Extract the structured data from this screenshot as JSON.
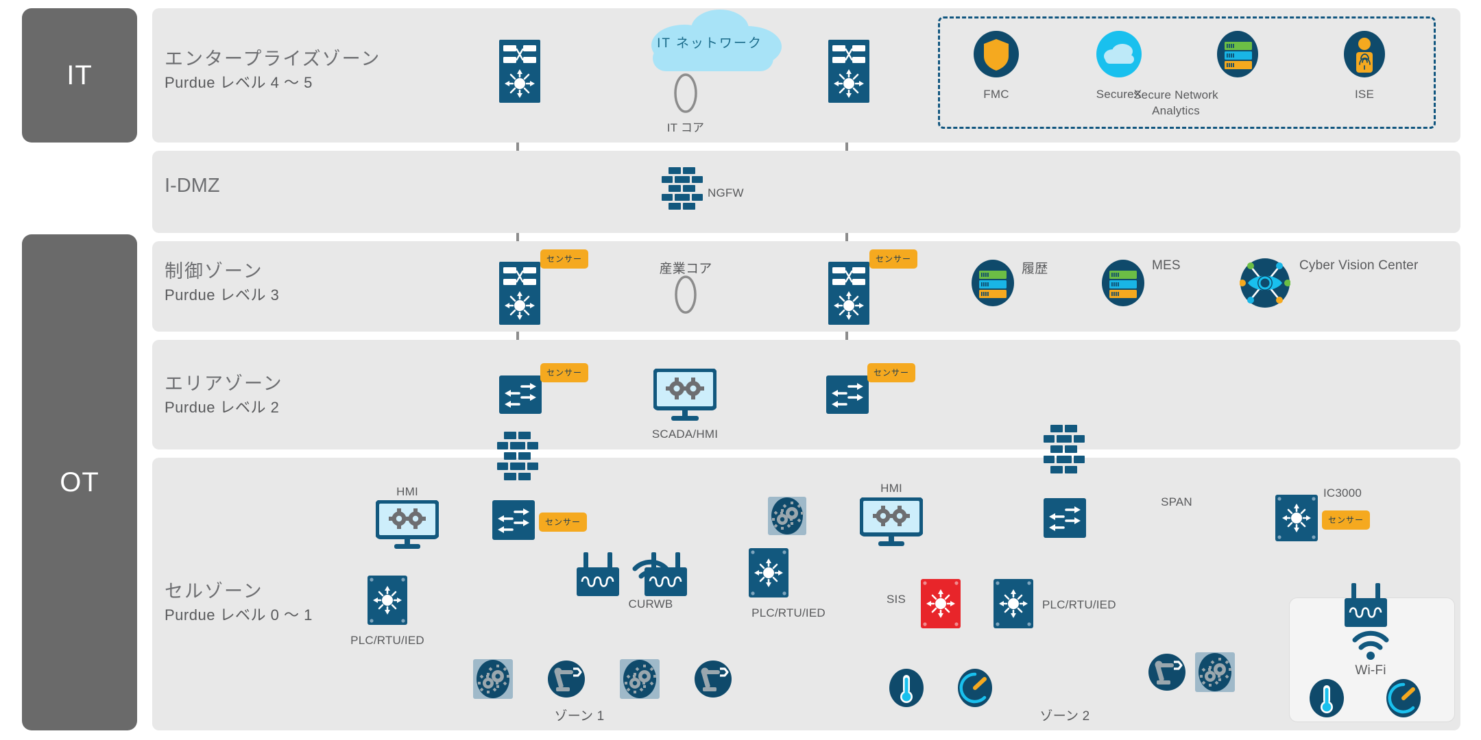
{
  "sidebars": [
    {
      "label": "IT",
      "name": "it-column"
    },
    {
      "label": "OT",
      "name": "ot-column"
    }
  ],
  "zones": [
    {
      "id": "enterprise",
      "title": "エンタープライズゾーン",
      "subtitle": "Purdue レベル 4 〜 5"
    },
    {
      "id": "idmz",
      "title": "I-DMZ",
      "subtitle": ""
    },
    {
      "id": "control",
      "title": "制御ゾーン",
      "subtitle": "Purdue レベル 3"
    },
    {
      "id": "area",
      "title": "エリアゾーン",
      "subtitle": "Purdue レベル 2"
    },
    {
      "id": "cell",
      "title": "セルゾーン",
      "subtitle": "Purdue レベル 0 〜 1"
    }
  ],
  "enterprise": {
    "cloud_label": "IT ネットワーク",
    "core_label": "IT コア",
    "security_tools": [
      {
        "label": "FMC",
        "icon": "shield-icon"
      },
      {
        "label": "SecureX",
        "icon": "cloud-icon"
      },
      {
        "label": "Secure Network Analytics",
        "icon": "server-stack-icon"
      },
      {
        "label": "ISE",
        "icon": "fingerprint-person-icon"
      }
    ]
  },
  "idmz": {
    "firewall_label": "NGFW"
  },
  "control": {
    "core_label": "産業コア",
    "sensor_badge": "センサー",
    "nodes": [
      {
        "label": "履歴",
        "icon": "server-stack-icon"
      },
      {
        "label": "MES",
        "icon": "server-stack-icon"
      },
      {
        "label": "Cyber Vision Center",
        "icon": "eye-icon"
      }
    ]
  },
  "area": {
    "sensor_badge": "センサー",
    "scada_label": "SCADA/HMI"
  },
  "cell": {
    "sensor_badge": "センサー",
    "left": {
      "hmi_label": "HMI",
      "plc_label": "PLC/RTU/IED",
      "plc_right_label": "PLC/RTU/IED",
      "curwb_label": "CURWB",
      "zone_label": "ゾーン 1"
    },
    "right": {
      "hmi_label": "HMI",
      "sis_label": "SIS",
      "plc_label": "PLC/RTU/IED",
      "span_label": "SPAN",
      "ic3000_label": "IC3000",
      "zone_label": "ゾーン 2",
      "wifi_label": "Wi-Fi"
    }
  },
  "colors": {
    "deep_blue": "#12587e",
    "dark_navy": "#0f4a6b",
    "orange": "#f5a91f",
    "cyan": "#19b5e6",
    "green": "#6cbe45",
    "red": "#e8252a",
    "band_grey": "#e8e8e8",
    "sidebar_grey": "#6a6a6a",
    "wire_grey": "#8c8c8c",
    "light_blue": "#a8e3f7"
  }
}
